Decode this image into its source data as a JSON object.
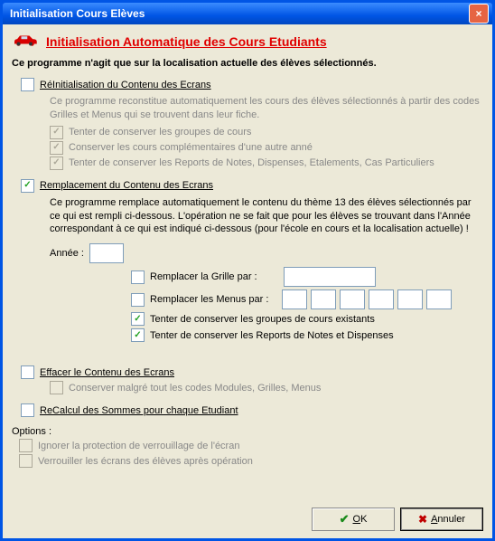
{
  "window": {
    "title": "Initialisation Cours Elèves"
  },
  "header": {
    "title": "Initialisation Automatique des Cours Etudiants",
    "subtitle": "Ce programme n'agit que sur la localisation actuelle des élèves sélectionnés."
  },
  "sections": {
    "reinit": {
      "label": "RéInitialisation du Contenu des Ecrans",
      "desc": "Ce programme reconstitue automatiquement les cours des élèves sélectionnés à partir des codes Grilles et Menus qui se trouvent dans leur fiche.",
      "opts": [
        "Tenter de conserver les groupes de cours",
        "Conserver les cours complémentaires d'une autre anné",
        "Tenter de conserver les Reports de Notes, Dispenses, Etalements, Cas Particuliers"
      ]
    },
    "replace": {
      "label": "Remplacement du Contenu des Ecrans",
      "desc": "Ce programme remplace automatiquement le contenu du thème 13 des élèves sélectionnés par ce qui est rempli ci-dessous. L'opération ne se fait que pour les élèves se trouvant dans l'Année correspondant à ce qui est indiqué ci-dessous (pour l'école en cours et la localisation actuelle) !",
      "annee_label": "Année :",
      "annee_value": "",
      "grille_label": "Remplacer la Grille par :",
      "menus_label": "Remplacer les Menus par :",
      "opt_groupes": "Tenter de conserver les groupes de cours existants",
      "opt_reports": "Tenter de conserver les Reports de Notes et Dispenses"
    },
    "erase": {
      "label": "Effacer le Contenu des Ecrans",
      "opt": "Conserver malgré tout les codes Modules, Grilles, Menus"
    },
    "recalcul": {
      "label": "ReCalcul des Sommes pour chaque Etudiant"
    }
  },
  "options": {
    "heading": "Options :",
    "items": [
      "Ignorer la protection de verrouillage de l'écran",
      "Verrouiller les écrans des élèves après opération"
    ]
  },
  "buttons": {
    "ok_u": "O",
    "ok_rest": "K",
    "cancel_u": "A",
    "cancel_rest": "nnuler"
  }
}
